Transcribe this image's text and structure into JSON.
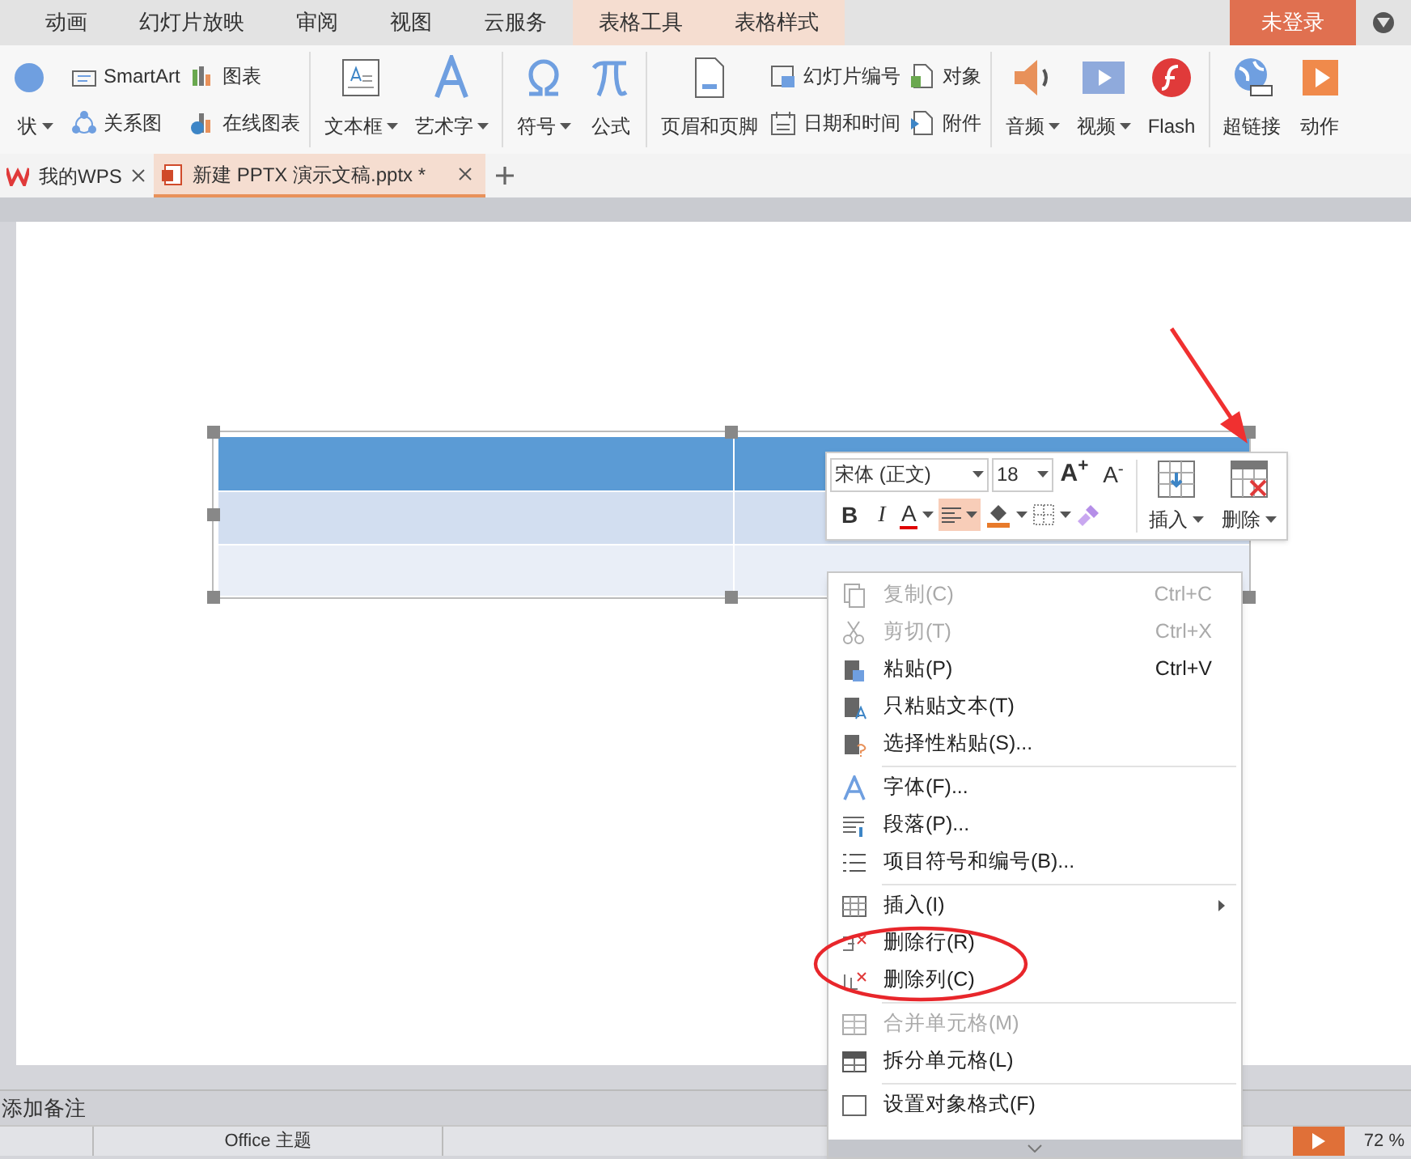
{
  "menu_tabs": [
    {
      "label": "动画",
      "contextual": false
    },
    {
      "label": "幻灯片放映",
      "contextual": false
    },
    {
      "label": "审阅",
      "contextual": false
    },
    {
      "label": "视图",
      "contextual": false
    },
    {
      "label": "云服务",
      "contextual": false
    },
    {
      "label": "表格工具",
      "contextual": true
    },
    {
      "label": "表格样式",
      "contextual": true
    }
  ],
  "login_button": "未登录",
  "ribbon": {
    "groups": [
      {
        "items": [
          {
            "label": "状",
            "kind": "large",
            "dropdown": true
          },
          {
            "label": "SmartArt",
            "kind": "small",
            "dropdown": false
          },
          {
            "label": "关系图",
            "kind": "small",
            "dropdown": false
          },
          {
            "label": "图表",
            "kind": "small",
            "dropdown": false
          },
          {
            "label": "在线图表",
            "kind": "small",
            "dropdown": false
          }
        ]
      },
      {
        "items": [
          {
            "label": "文本框",
            "kind": "large",
            "dropdown": true
          },
          {
            "label": "艺术字",
            "kind": "large",
            "dropdown": true
          }
        ]
      },
      {
        "items": [
          {
            "label": "符号",
            "kind": "large",
            "dropdown": true
          },
          {
            "label": "公式",
            "kind": "large",
            "dropdown": false
          }
        ]
      },
      {
        "items": [
          {
            "label": "页眉和页脚",
            "kind": "large",
            "dropdown": false
          },
          {
            "label": "幻灯片编号",
            "kind": "small",
            "dropdown": false
          },
          {
            "label": "日期和时间",
            "kind": "small",
            "dropdown": false
          },
          {
            "label": "对象",
            "kind": "small",
            "dropdown": false
          },
          {
            "label": "附件",
            "kind": "small",
            "dropdown": false
          }
        ]
      },
      {
        "items": [
          {
            "label": "音频",
            "kind": "large",
            "dropdown": true
          },
          {
            "label": "视频",
            "kind": "large",
            "dropdown": true
          },
          {
            "label": "Flash",
            "kind": "large",
            "dropdown": false
          }
        ]
      },
      {
        "items": [
          {
            "label": "超链接",
            "kind": "large",
            "dropdown": false
          },
          {
            "label": "动作",
            "kind": "large",
            "dropdown": false
          }
        ]
      }
    ]
  },
  "doc_tabs": [
    {
      "label": "我的WPS",
      "selected": false
    },
    {
      "label": "新建 PPTX 演示文稿.pptx *",
      "selected": true
    }
  ],
  "slide": {
    "table": {
      "rows": [
        {
          "kind": "header"
        },
        {
          "kind": "band"
        },
        {
          "kind": "plain"
        }
      ]
    }
  },
  "mini_toolbar": {
    "font": "宋体 (正文)",
    "size": "18",
    "grow": "A$^{+}$",
    "shrink": "A$^{-}$",
    "bold": "B",
    "italic": "I",
    "font_color": "A",
    "align_active": true,
    "insert": "插入",
    "delete": "删除"
  },
  "context_menu": [
    {
      "kind": "item",
      "label": "复制(C)",
      "shortcut": "Ctrl+C",
      "disabled": true
    },
    {
      "kind": "item",
      "label": "剪切(T)",
      "shortcut": "Ctrl+X",
      "disabled": true
    },
    {
      "kind": "item",
      "label": "粘贴(P)",
      "shortcut": "Ctrl+V",
      "disabled": false
    },
    {
      "kind": "item",
      "label": "只粘贴文本(T)",
      "disabled": false
    },
    {
      "kind": "item",
      "label": "选择性粘贴(S)...",
      "disabled": false
    },
    {
      "kind": "separator"
    },
    {
      "kind": "item",
      "label": "字体(F)...",
      "disabled": false
    },
    {
      "kind": "item",
      "label": "段落(P)...",
      "disabled": false
    },
    {
      "kind": "item",
      "label": "项目符号和编号(B)...",
      "disabled": false
    },
    {
      "kind": "separator"
    },
    {
      "kind": "item",
      "label": "插入(I)",
      "disabled": false,
      "submenu": true
    },
    {
      "kind": "item",
      "label": "删除行(R)",
      "disabled": false
    },
    {
      "kind": "item",
      "label": "删除列(C)",
      "disabled": false
    },
    {
      "kind": "separator"
    },
    {
      "kind": "item",
      "label": "合并单元格(M)",
      "disabled": true
    },
    {
      "kind": "item",
      "label": "拆分单元格(L)",
      "disabled": false
    },
    {
      "kind": "separator"
    },
    {
      "kind": "item",
      "label": "设置对象格式(F)",
      "disabled": false
    }
  ],
  "notes": {
    "placeholder": "添加备注"
  },
  "status_bar": {
    "theme": "Office 主题",
    "zoom": "72 %"
  },
  "annotations": {
    "arrow": true,
    "highlight_ellipse": true
  }
}
